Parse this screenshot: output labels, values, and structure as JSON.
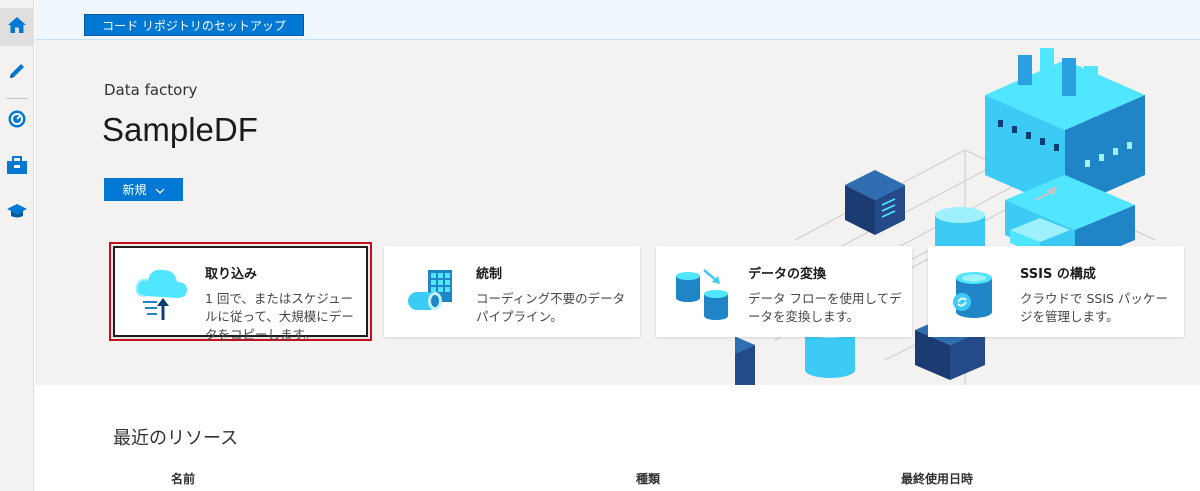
{
  "sidebar": {
    "items": [
      {
        "name": "home",
        "icon": "home-icon",
        "active": true
      },
      {
        "name": "author",
        "icon": "pencil-icon",
        "active": false
      },
      {
        "name": "monitor",
        "icon": "gauge-icon",
        "active": false
      },
      {
        "name": "manage",
        "icon": "toolbox-icon",
        "active": false
      },
      {
        "name": "learning",
        "icon": "graduation-cap-icon",
        "active": false
      }
    ]
  },
  "topbar": {
    "repo_button_label": "コード リポジトリのセットアップ"
  },
  "hero": {
    "kicker": "Data factory",
    "title": "SampleDF",
    "new_button_label": "新規"
  },
  "cards": [
    {
      "title": "取り込み",
      "desc": "1 回で、またはスケジュールに従って、大規模にデータをコピーします。",
      "icon": "cloud-upload-icon",
      "selected": true
    },
    {
      "title": "統制",
      "desc": "コーディング不要のデータ パイプライン。",
      "icon": "orchestrate-icon",
      "selected": false
    },
    {
      "title": "データの変換",
      "desc": "データ フローを使用してデータを変換します。",
      "icon": "transform-data-icon",
      "selected": false
    },
    {
      "title": "SSIS の構成",
      "desc": "クラウドで SSIS パッケージを管理します。",
      "icon": "ssis-icon",
      "selected": false
    }
  ],
  "recent": {
    "heading": "最近のリソース",
    "columns": [
      "名前",
      "種類",
      "最終使用日時"
    ]
  },
  "colors": {
    "accent": "#0078d4",
    "selection_outline": "#c50f1f"
  }
}
